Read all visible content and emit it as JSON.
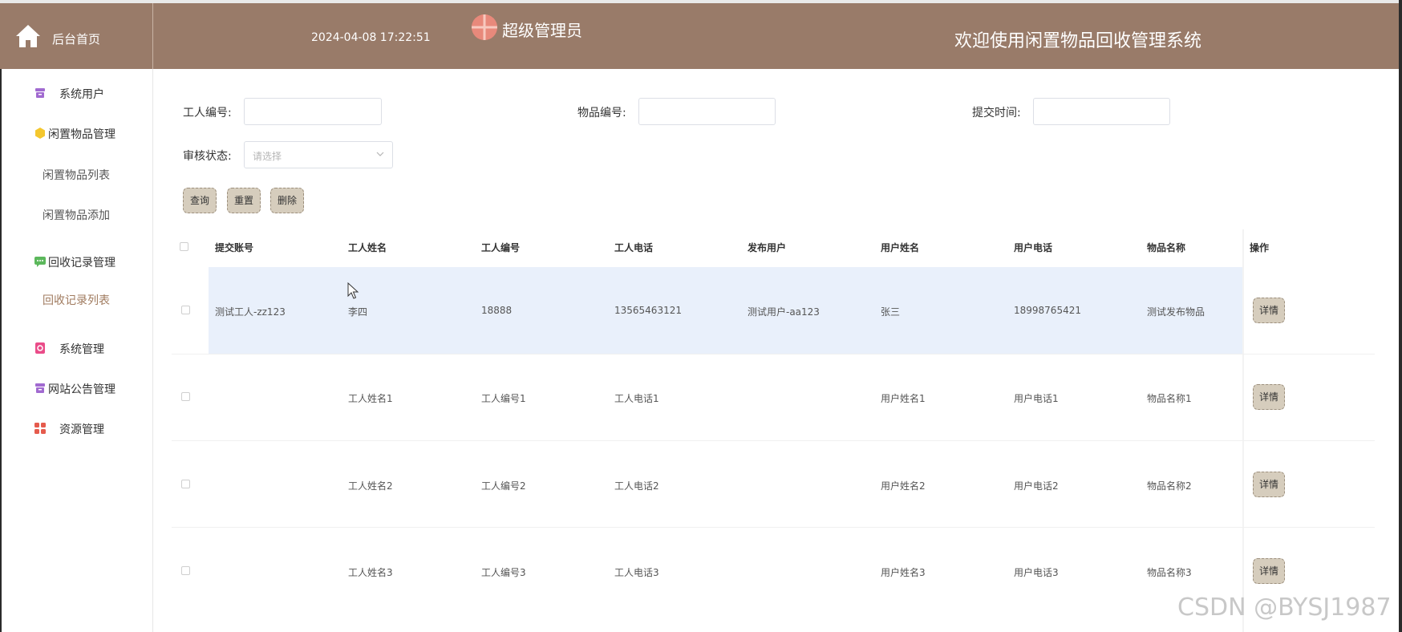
{
  "header": {
    "home_label": "后台首页",
    "datetime": "2024-04-08 17:22:51",
    "role": "超级管理员",
    "title": "欢迎使用闲置物品回收管理系统"
  },
  "sidebar": {
    "items": [
      {
        "label": "系统用户",
        "icon": "archive-icon",
        "color": "#9b59b6"
      },
      {
        "label": "闲置物品管理",
        "icon": "cube-icon",
        "color": "#f1c40f"
      },
      {
        "label": "回收记录管理",
        "icon": "chat-icon",
        "color": "#5cb85c"
      },
      {
        "label": "系统管理",
        "icon": "settings-doc-icon",
        "color": "#e84393"
      },
      {
        "label": "网站公告管理",
        "icon": "archive-icon",
        "color": "#9b59b6"
      },
      {
        "label": "资源管理",
        "icon": "grid-icon",
        "color": "#e74c3c"
      }
    ],
    "subs": {
      "item_list": "闲置物品列表",
      "item_add": "闲置物品添加",
      "record_list": "回收记录列表"
    }
  },
  "filters": {
    "worker_no_label": "工人编号:",
    "item_no_label": "物品编号:",
    "submit_time_label": "提交时间:",
    "audit_label": "审核状态:",
    "audit_placeholder": "请选择"
  },
  "buttons": {
    "query": "查询",
    "reset": "重置",
    "delete": "删除"
  },
  "table": {
    "columns": [
      "提交账号",
      "工人姓名",
      "工人编号",
      "工人电话",
      "发布用户",
      "用户姓名",
      "用户电话",
      "物品名称",
      "操作"
    ],
    "rows": [
      [
        "测试工人-zz123",
        "李四",
        "18888",
        "13565463121",
        "测试用户-aa123",
        "张三",
        "18998765421",
        "测试发布物品"
      ],
      [
        "",
        "工人姓名1",
        "工人编号1",
        "工人电话1",
        "",
        "用户姓名1",
        "用户电话1",
        "物品名称1"
      ],
      [
        "",
        "工人姓名2",
        "工人编号2",
        "工人电话2",
        "",
        "用户姓名2",
        "用户电话2",
        "物品名称2"
      ],
      [
        "",
        "工人姓名3",
        "工人编号3",
        "工人电话3",
        "",
        "用户姓名3",
        "用户电话3",
        "物品名称3"
      ]
    ],
    "detail_label": "详情"
  },
  "watermark": "CSDN @BYSJ1987"
}
